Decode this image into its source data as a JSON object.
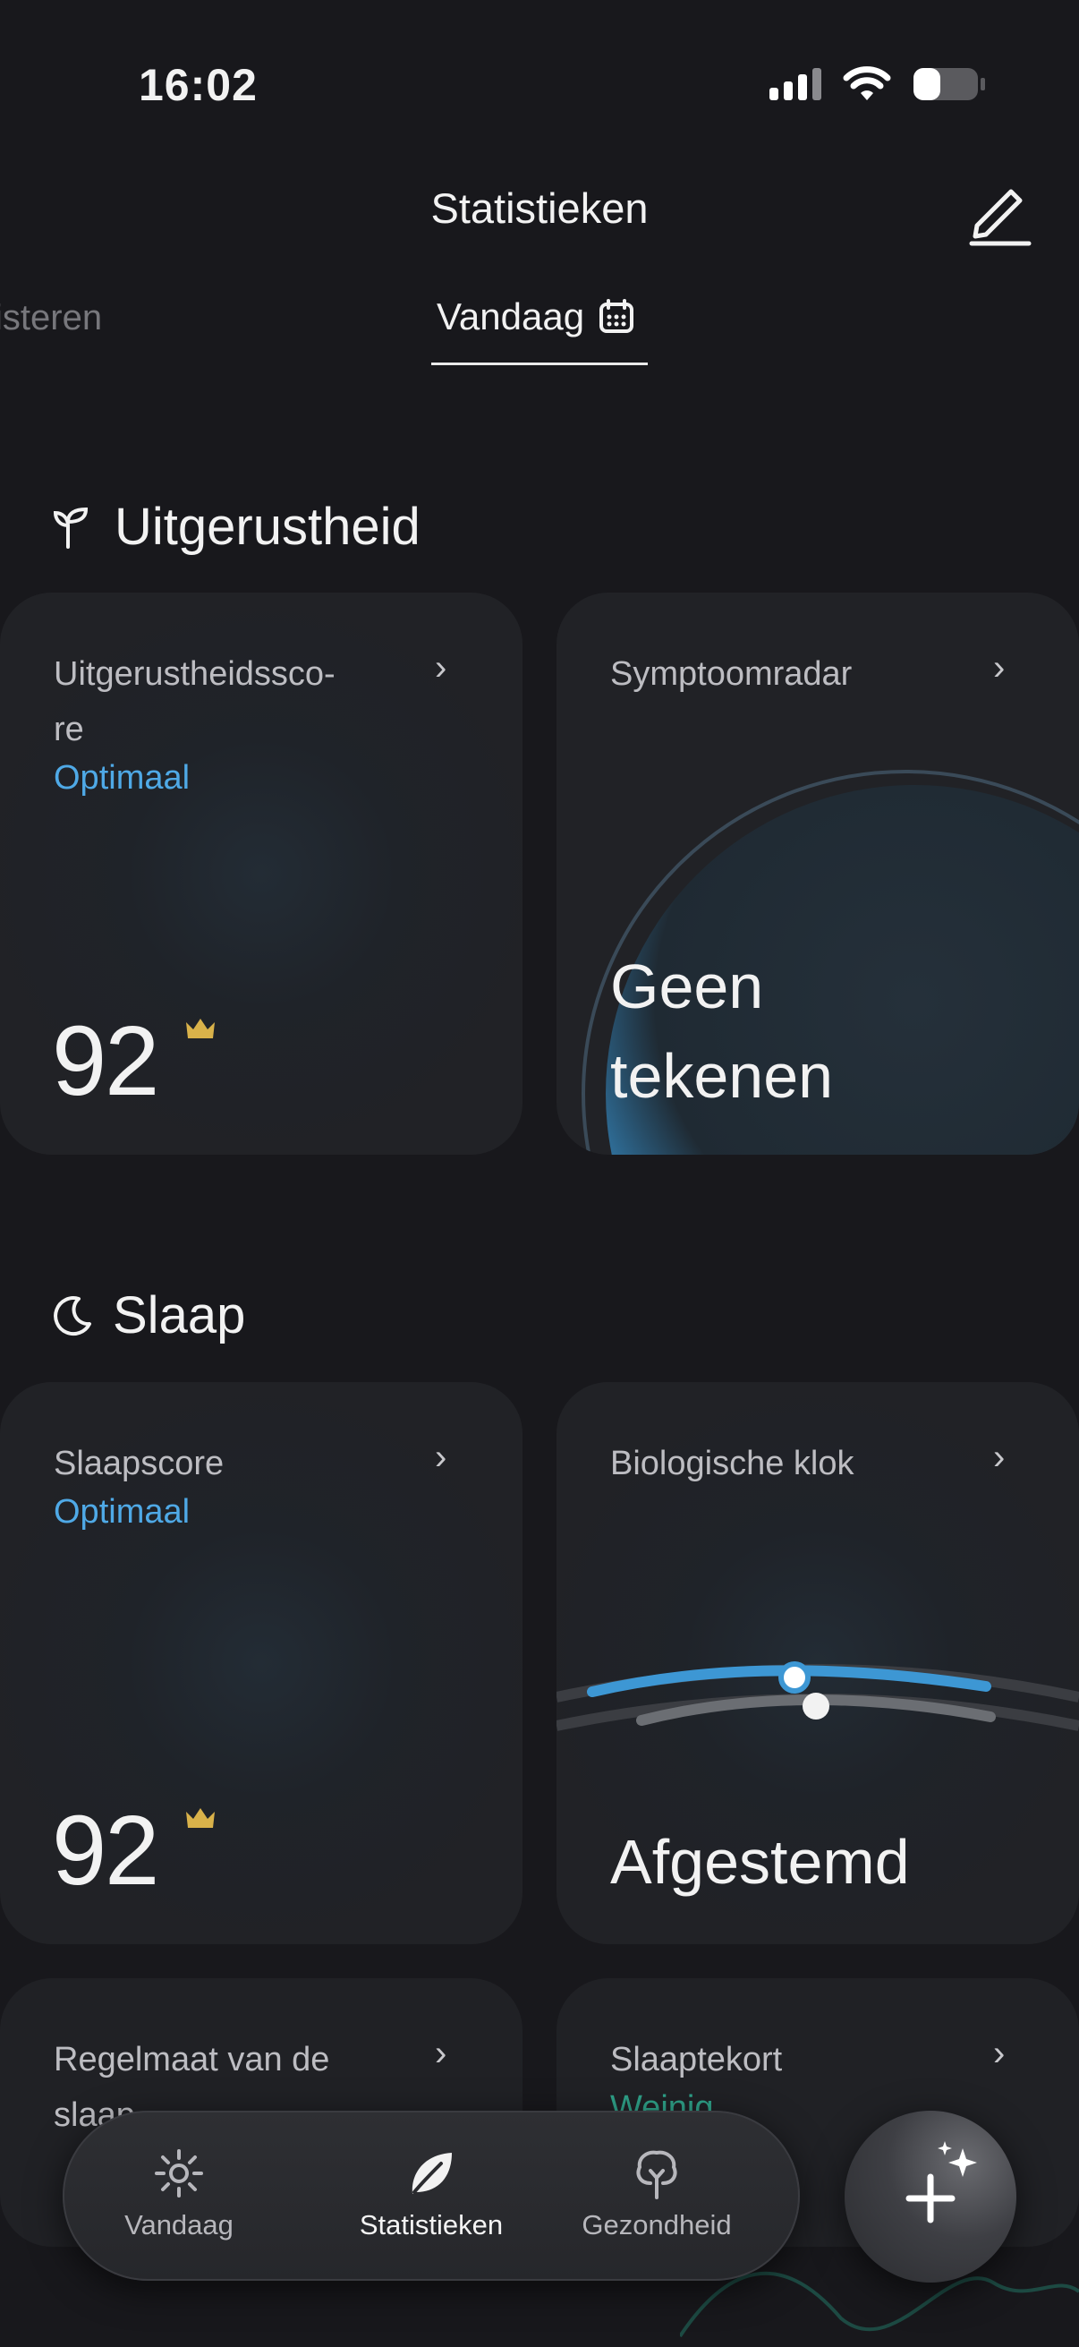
{
  "status_bar": {
    "time": "16:02"
  },
  "header": {
    "title": "Statistieken"
  },
  "tabs": {
    "previous": "isteren",
    "current": "Vandaag"
  },
  "sections": {
    "rest": {
      "title": "Uitgerustheid",
      "cards": {
        "score": {
          "label_line1": "Uitgerustheidssco-",
          "label_line2": "re",
          "status": "Optimaal",
          "value": "92"
        },
        "radar": {
          "label": "Symptoomradar",
          "value_line1": "Geen",
          "value_line2": "tekenen"
        }
      }
    },
    "sleep": {
      "title": "Slaap",
      "cards": {
        "score": {
          "label": "Slaapscore",
          "status": "Optimaal",
          "value": "92"
        },
        "clock": {
          "label": "Biologische klok",
          "value": "Afgestemd"
        },
        "regularity": {
          "label_line1": "Regelmaat van de",
          "label_line2": "slaap"
        },
        "deficit": {
          "label": "Slaaptekort",
          "status": "Weinig"
        }
      }
    }
  },
  "bottom_nav": {
    "items": [
      {
        "label": "Vandaag",
        "icon": "sun-icon"
      },
      {
        "label": "Statistieken",
        "icon": "leaf-icon"
      },
      {
        "label": "Gezondheid",
        "icon": "tree-icon"
      }
    ]
  },
  "fab": {
    "icon": "plus-sparkle-icon"
  },
  "colors": {
    "accent": "#4fa9e6",
    "crown": "#d9b24a",
    "background": "#18181c",
    "status_green": "#2fa38a"
  }
}
